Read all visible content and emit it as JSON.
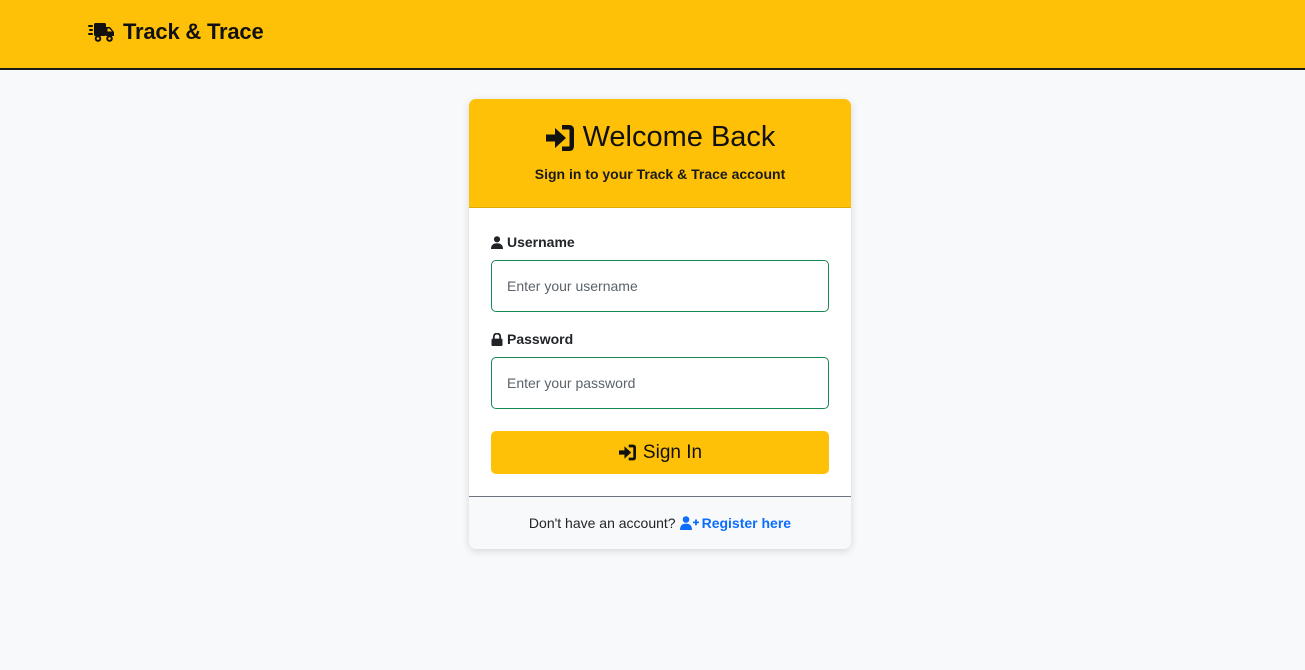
{
  "navbar": {
    "brand_icon": "truck-fast-icon",
    "brand_text": "Track & Trace",
    "background": "#ffc107"
  },
  "login_card": {
    "header_icon": "sign-in-icon",
    "title": "Welcome Back",
    "subtitle": "Sign in to your Track & Trace account",
    "username": {
      "icon": "user-icon",
      "label": "Username",
      "placeholder": "Enter your username",
      "value": ""
    },
    "password": {
      "icon": "lock-icon",
      "label": "Password",
      "placeholder": "Enter your password",
      "value": ""
    },
    "submit": {
      "icon": "sign-in-icon",
      "label": "Sign In"
    },
    "footer": {
      "prompt": "Don't have an account?",
      "link_icon": "user-plus-icon",
      "link_label": "Register here",
      "link_color": "#0d6efd"
    }
  },
  "colors": {
    "accent": "#ffc107",
    "input_border": "#198754",
    "page_background": "#f8f9fa"
  }
}
